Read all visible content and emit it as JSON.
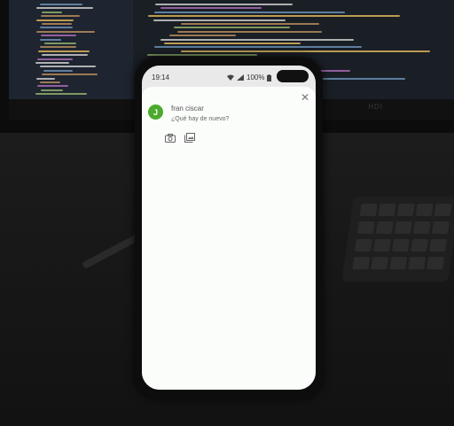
{
  "status_bar": {
    "time": "19:14",
    "battery": "100%"
  },
  "composer": {
    "avatar_letter": "J",
    "user_name": "fran ciscar",
    "prompt": "¿Qué hay de nuevo?",
    "close_glyph": "✕",
    "actions": [
      {
        "icon": "camera-icon"
      },
      {
        "icon": "gallery-icon"
      }
    ]
  },
  "monitor": {
    "brand": "HDI"
  },
  "colors": {
    "avatar": "#4caa2c",
    "sheet": "#fbfdfb"
  }
}
